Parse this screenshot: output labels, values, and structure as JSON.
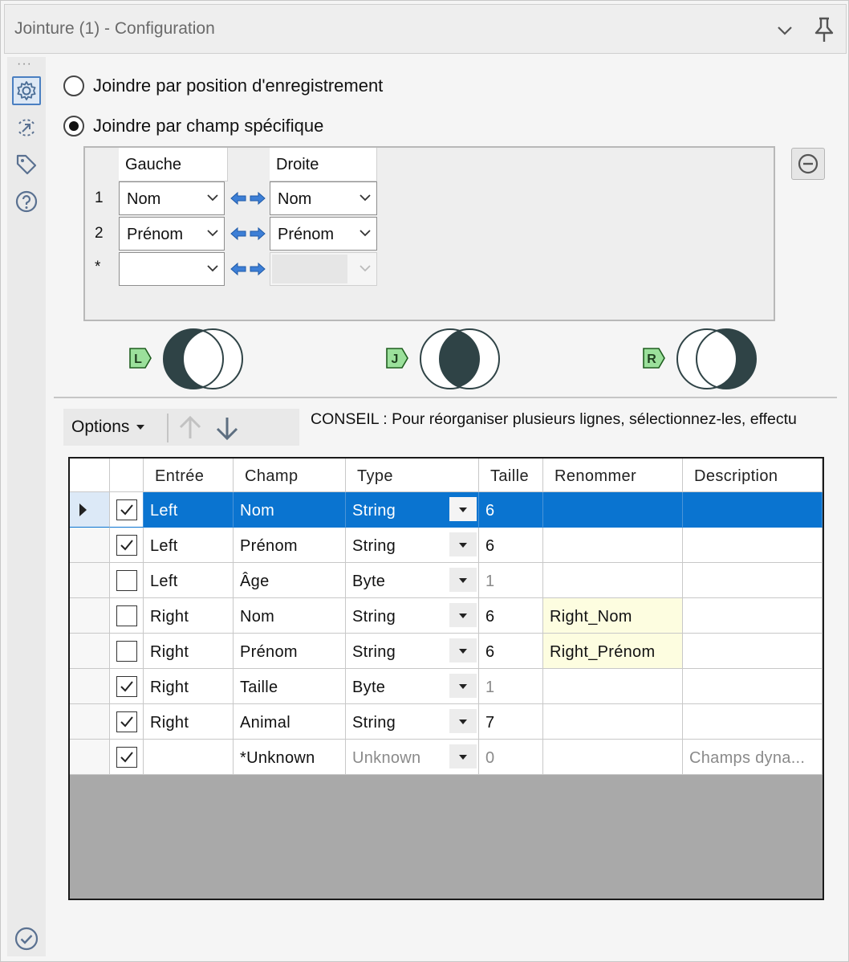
{
  "window": {
    "title": "Jointure (1) - Configuration",
    "icons": [
      "chevron-down-icon",
      "pin-icon"
    ]
  },
  "sidebar": {
    "dots": "···",
    "icons": [
      "gear-icon",
      "connection-icon",
      "tag-icon",
      "help-icon"
    ],
    "status_icon": "check-circle-icon"
  },
  "join_mode": {
    "options": [
      {
        "label": "Joindre par position d'enregistrement",
        "checked": false
      },
      {
        "label": "Joindre par champ spécifique",
        "checked": true
      }
    ]
  },
  "join_fields": {
    "headers": {
      "left": "Gauche",
      "right": "Droite"
    },
    "rows": [
      {
        "num": "1",
        "left": "Nom",
        "right": "Nom"
      },
      {
        "num": "2",
        "left": "Prénom",
        "right": "Prénom"
      },
      {
        "num": "*",
        "left": "",
        "right": ""
      }
    ],
    "remove_icon": "minus-circle-icon"
  },
  "outputs": {
    "left": {
      "badge": "L"
    },
    "join": {
      "badge": "J"
    },
    "right": {
      "badge": "R"
    },
    "color": "#2f4346"
  },
  "toolbar": {
    "options_label": "Options",
    "up_icon": "arrow-up-icon",
    "down_icon": "arrow-down-icon",
    "tip": "CONSEIL : Pour réorganiser plusieurs lignes, sélectionnez-les, effectu"
  },
  "fields_grid": {
    "headers": [
      "Entrée",
      "Champ",
      "Type",
      "Taille",
      "Renommer",
      "Description"
    ],
    "rows": [
      {
        "checked": true,
        "input": "Left",
        "field": "Nom",
        "type": "String",
        "size": "6",
        "rename": "",
        "description": "",
        "selected": true
      },
      {
        "checked": true,
        "input": "Left",
        "field": "Prénom",
        "type": "String",
        "size": "6",
        "rename": "",
        "description": ""
      },
      {
        "checked": false,
        "input": "Left",
        "field": "Âge",
        "type": "Byte",
        "size": "1",
        "rename": "",
        "description": ""
      },
      {
        "checked": false,
        "input": "Right",
        "field": "Nom",
        "type": "String",
        "size": "6",
        "rename": "Right_Nom",
        "description": ""
      },
      {
        "checked": false,
        "input": "Right",
        "field": "Prénom",
        "type": "String",
        "size": "6",
        "rename": "Right_Prénom",
        "description": ""
      },
      {
        "checked": true,
        "input": "Right",
        "field": "Taille",
        "type": "Byte",
        "size": "1",
        "rename": "",
        "description": ""
      },
      {
        "checked": true,
        "input": "Right",
        "field": "Animal",
        "type": "String",
        "size": "7",
        "rename": "",
        "description": ""
      },
      {
        "checked": true,
        "input": "",
        "field": "*Unknown",
        "type": "Unknown",
        "size": "0",
        "rename": "",
        "description": "Champs dyna..."
      }
    ]
  },
  "colors": {
    "selection": "#0a74d0",
    "rename_highlight": "#fdfde0",
    "badge_fill": "#9be09b"
  }
}
